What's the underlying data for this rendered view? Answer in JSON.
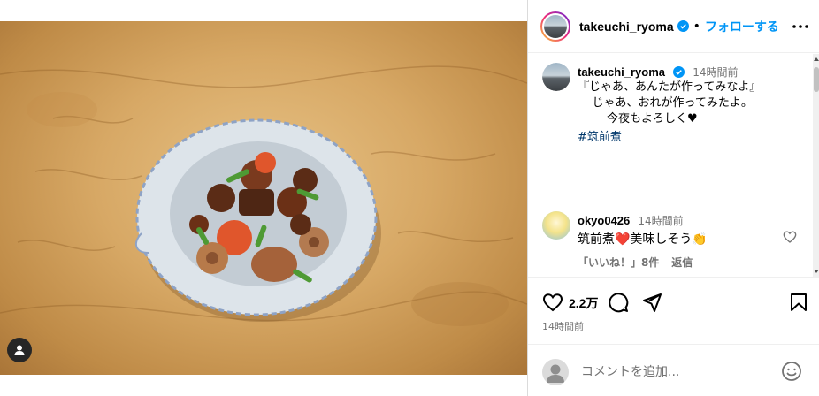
{
  "post": {
    "username": "takeuchi_ryoma",
    "follow_label": "フォローする",
    "dot": "•"
  },
  "caption": {
    "username": "takeuchi_ryoma",
    "time": "14時間前",
    "lines": [
      "『じゃあ、あんたが作ってみなよ』",
      "",
      "    じゃあ、おれが作ってみたよ。",
      "",
      "        今夜もよろしく♥",
      ""
    ],
    "hashtag": "#筑前煮"
  },
  "comment": {
    "username": "okyo0426",
    "time": "14時間前",
    "text": "筑前煮❤️美味しそう👏",
    "likes_label": "「いいね！」8件",
    "reply_label": "返信"
  },
  "actions": {
    "likes": "2.2万",
    "posted_ago": "14時間前"
  },
  "composer": {
    "placeholder": "コメントを追加..."
  },
  "colors": {
    "link_blue": "#0095f6",
    "secondary_text": "#737373",
    "verified_blue": "#0095f6"
  },
  "icons": [
    "person-tag-icon",
    "verified-icon",
    "more-icon",
    "heart-icon",
    "comment-icon",
    "share-icon",
    "bookmark-icon",
    "emoji-icon"
  ]
}
